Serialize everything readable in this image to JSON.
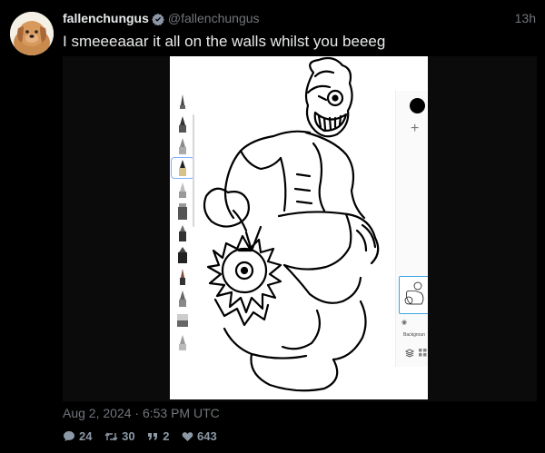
{
  "author": {
    "display_name": "fallenchungus",
    "handle": "@fallenchungus",
    "verified": true,
    "avatar_icon": "dog-avatar"
  },
  "time_ago": "13h",
  "text": "I smeeeaaar it all on the walls whilst you beeeg",
  "media": {
    "kind": "drawing-app-screenshot",
    "layers": {
      "background_label": "Backgroun"
    },
    "current_color": "#000000"
  },
  "timestamp": "Aug 2, 2024 · 6:53 PM UTC",
  "stats": {
    "replies": "24",
    "retweets": "30",
    "quotes": "2",
    "likes": "643"
  },
  "colors": {
    "verified": "#8b98a5",
    "muted": "#71767b",
    "text": "#e7e9ea",
    "background": "#000000"
  }
}
